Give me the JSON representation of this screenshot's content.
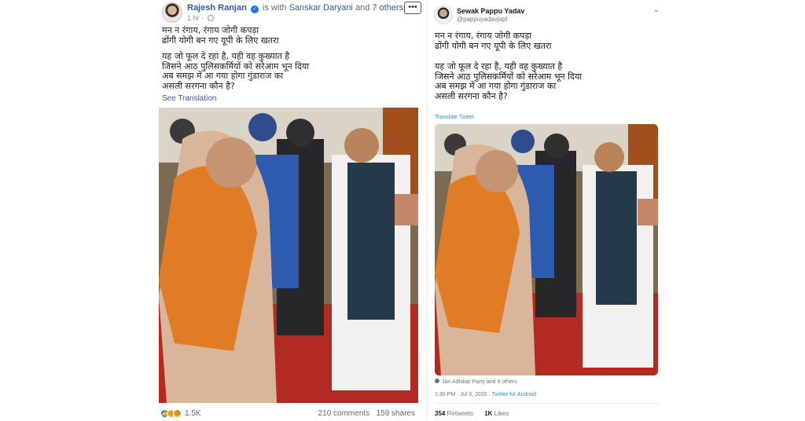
{
  "facebook": {
    "author": "Rajesh Ranjan",
    "with_prefix": "is with",
    "with_people": "Sanskar Daryani",
    "with_and": "and",
    "with_others": "7 others.",
    "time": "1 hr",
    "menu_icon": "more-icon",
    "lines_block1": [
      "मन न रंगाय, रंगाय जोगी कपड़ा",
      "ढोंगी योगी बन गए यूपी के लिए खतरा"
    ],
    "lines_block2": [
      "यह जो फूल दे रहा है, यही वह कुख्यात है",
      "जिसने आठ पुलिसकर्मियों को सरेआम भून दिया",
      "अब समझ में आ गया होगा गुंडाराज का",
      "असली सरगना कौन है?"
    ],
    "see_translation": "See Translation",
    "reactions_count": "1.5K",
    "comments": "210 comments",
    "shares": "159 shares",
    "colors": {
      "link": "#365899",
      "verified": "#1877f2"
    }
  },
  "twitter": {
    "author": "Sewak Pappu Yadav",
    "handle": "@pappuyadavjapl",
    "lines_block1": [
      "मन न रंगाय, रंगाय जोगी कपड़ा",
      "ढोंगी योगी बन गए यूपी के लिए खतरा"
    ],
    "lines_block2": [
      "यह जो फूल दे रहा है, यही वह कुख्यात है",
      "जिसने आठ पुलिसकर्मियों को सरेआम भून दिया",
      "अब समझ में आ गया होगा गुंडाराज का",
      "असली सरगना कौन है?"
    ],
    "translate": "Translate Tweet",
    "tagged": "Jan Adhikar Party and 9 others",
    "time": "1:30 PM · Jul 3, 2020 · ",
    "source": "Twitter for Android",
    "retweets_count": "354",
    "retweets_label": "Retweets",
    "likes_count": "1K",
    "likes_label": "Likes",
    "colors": {
      "link": "#1b95e0"
    }
  }
}
